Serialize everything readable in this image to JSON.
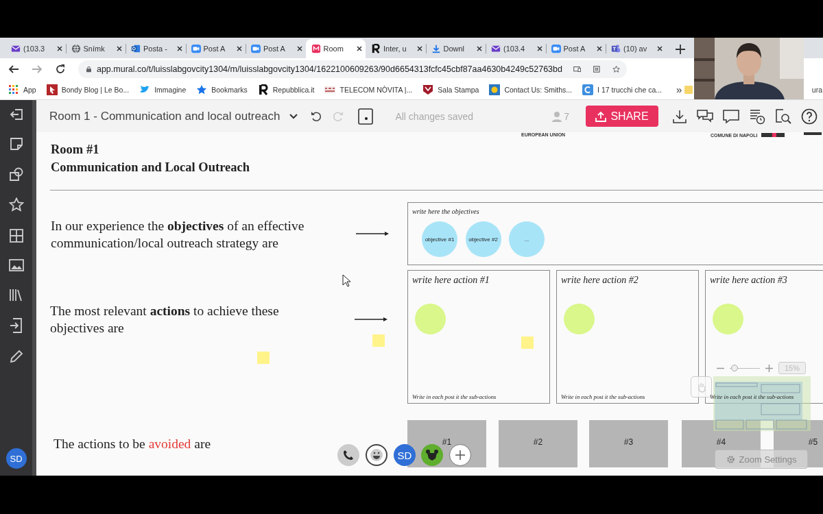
{
  "browser": {
    "tabs": [
      {
        "label": "(103.3",
        "kind": "mail",
        "selected": false
      },
      {
        "label": "Snímk",
        "kind": "globe",
        "selected": false
      },
      {
        "label": "Posta -",
        "kind": "outlook",
        "selected": false
      },
      {
        "label": "Post A",
        "kind": "zoom",
        "selected": false
      },
      {
        "label": "Post A",
        "kind": "zoom",
        "selected": false
      },
      {
        "label": "Room",
        "kind": "mural",
        "selected": true
      },
      {
        "label": "Inter, u",
        "kind": "letter",
        "selected": false
      },
      {
        "label": "Downl",
        "kind": "download",
        "selected": false
      },
      {
        "label": "(103.4",
        "kind": "mail",
        "selected": false
      },
      {
        "label": "Post A",
        "kind": "zoom",
        "selected": false
      },
      {
        "label": "(10) av",
        "kind": "teams",
        "selected": false
      }
    ],
    "url": "app.mural.co/t/luisslabgovcity1304/m/luisslabgovcity1304/1622100609263/90d6654313fcfc45cbf87aa4630b4249c52763bd",
    "bookmarks": [
      {
        "label": "App",
        "kind": "apps"
      },
      {
        "label": "Bondy Blog | Le Bo...",
        "kind": "cursor"
      },
      {
        "label": "Immagine",
        "kind": "bird"
      },
      {
        "label": "Bookmarks",
        "kind": "star"
      },
      {
        "label": "Repubblica.it",
        "kind": "letter"
      },
      {
        "label": "TELECOM NÒVITA |...",
        "kind": "telecom"
      },
      {
        "label": "Sala Stampa",
        "kind": "shield"
      },
      {
        "label": "Contact Us: Smiths...",
        "kind": "sun"
      },
      {
        "label": "I 17 trucchi che ca...",
        "kind": "badge"
      }
    ],
    "bookmarks_overflow": "»",
    "folder": {
      "label": "ura"
    }
  },
  "app": {
    "title": "Room 1 - Communication and local outreach",
    "redo_disabled": true,
    "save_status": "All changes saved",
    "collaborators": "7",
    "share": "SHARE",
    "user": "SD"
  },
  "board": {
    "logos": [
      "EUROPEAN UNION",
      "COMUNE DI NAPOLI"
    ],
    "heading": [
      "Room #1",
      "Communication and Local Outreach"
    ],
    "prompts": [
      {
        "parts": [
          {
            "text": "In our experience the ",
            "highlight": false
          },
          {
            "text": "objectives",
            "highlight": false,
            "bold": true
          },
          {
            "text": " of an effective communication/local outreach strategy are",
            "highlight": false
          }
        ]
      },
      {
        "parts": [
          {
            "text": "The most relevant ",
            "highlight": false
          },
          {
            "text": "actions",
            "highlight": false,
            "bold": true
          },
          {
            "text": " to achieve these objectives are",
            "highlight": false
          }
        ]
      },
      {
        "parts": [
          {
            "text": "The actions to be ",
            "highlight": false
          },
          {
            "text": "avoided",
            "highlight": true
          },
          {
            "text": " are",
            "highlight": false
          }
        ]
      }
    ],
    "objectives": {
      "title": "write here the objectives",
      "items": [
        "objective #1",
        "objective #2",
        "..."
      ]
    },
    "actions": [
      {
        "title": "write here action #1",
        "footer": "Write in each post it the sub-actions"
      },
      {
        "title": "write here action #2",
        "footer": "Write in each post it the sub-actions"
      },
      {
        "title": "write here action #3",
        "footer": "Write in each post it the sub-actions"
      }
    ],
    "avoided": [
      "#1",
      "#2",
      "#3",
      "#4",
      "#5"
    ]
  },
  "zoom_panel": {
    "level": 0.15,
    "reading": "15%",
    "settings": "Zoom Settings"
  },
  "call": {
    "avatar": "SD"
  }
}
